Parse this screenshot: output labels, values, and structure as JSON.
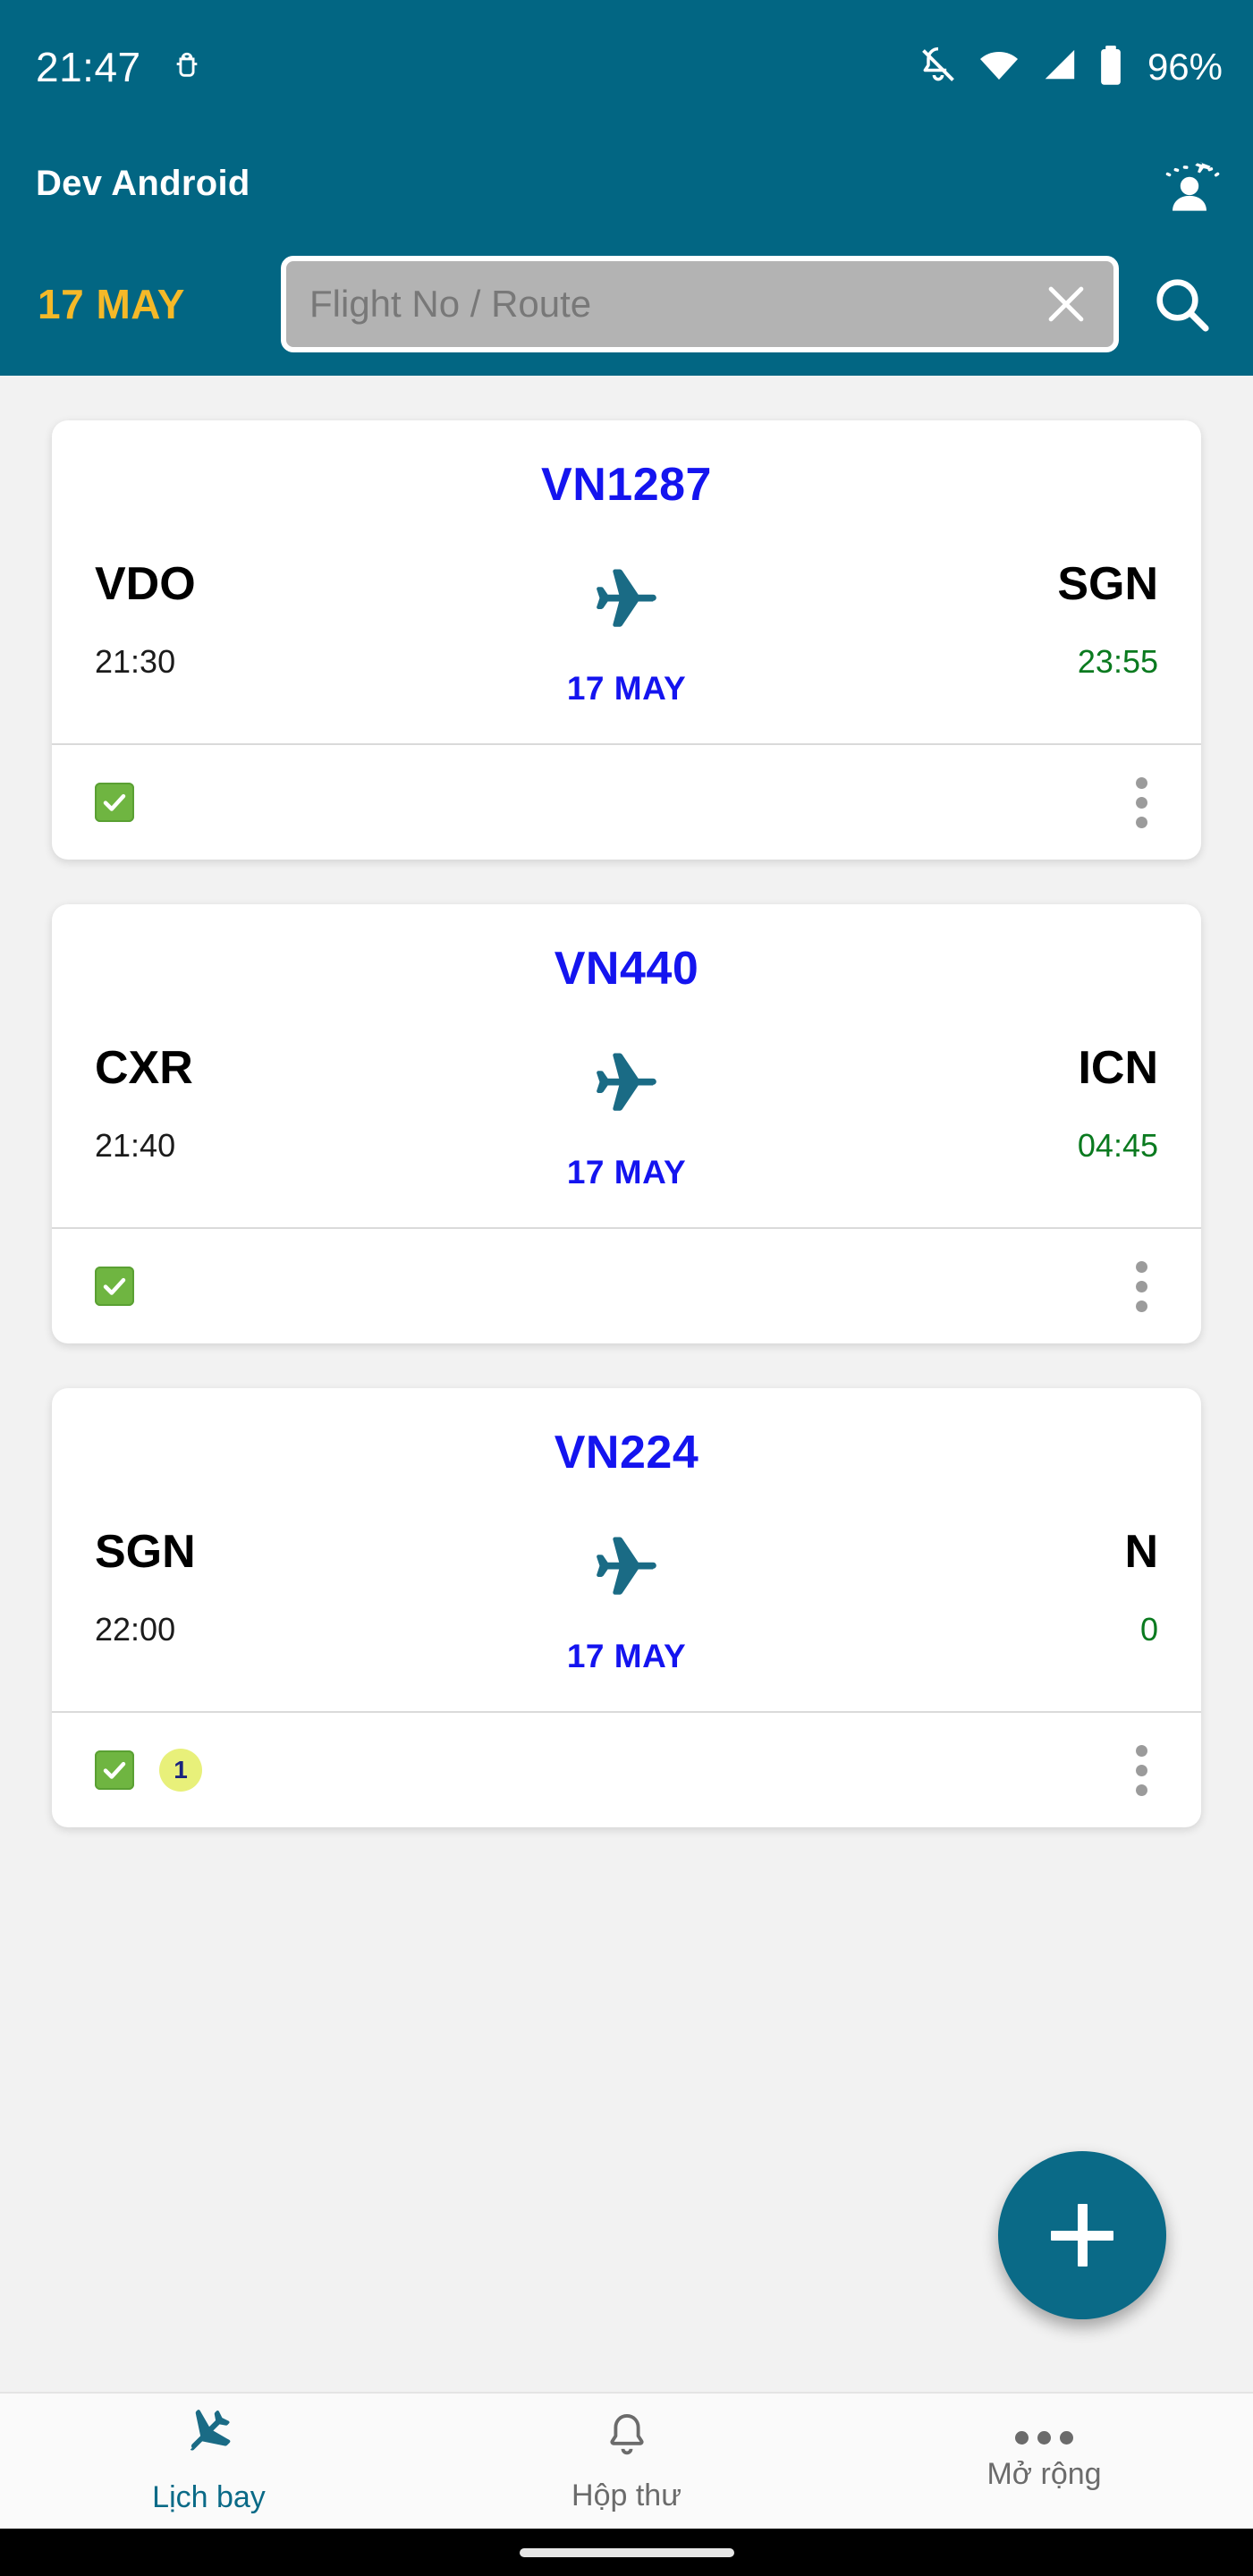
{
  "status_bar": {
    "clock": "21:47",
    "battery_text": "96%",
    "icons": [
      "android-debug-icon",
      "notifications-off-icon",
      "wifi-icon",
      "cellular-signal-icon",
      "battery-icon"
    ]
  },
  "app_bar": {
    "title": "Dev Android",
    "profile_icon": "crew-profile-icon",
    "date_label": "17 MAY",
    "search": {
      "placeholder": "Flight No / Route",
      "value": "",
      "clear_icon": "close-icon",
      "search_icon": "search-icon"
    }
  },
  "flights": [
    {
      "flight_no": "VN1287",
      "origin": "VDO",
      "destination": "SGN",
      "departure_time": "21:30",
      "arrival_time": "23:55",
      "date": "17 MAY",
      "checked": true,
      "badge": "",
      "menu_icon": "overflow-menu-icon",
      "plane_icon": "airplane-icon",
      "check_icon": "check-mark-icon"
    },
    {
      "flight_no": "VN440",
      "origin": "CXR",
      "destination": "ICN",
      "departure_time": "21:40",
      "arrival_time": "04:45",
      "date": "17 MAY",
      "checked": true,
      "badge": "",
      "menu_icon": "overflow-menu-icon",
      "plane_icon": "airplane-icon",
      "check_icon": "check-mark-icon"
    },
    {
      "flight_no": "VN224",
      "origin": "SGN",
      "destination": "N",
      "departure_time": "22:00",
      "arrival_time": "0",
      "date": "17 MAY",
      "checked": true,
      "badge": "1",
      "menu_icon": "overflow-menu-icon",
      "plane_icon": "airplane-icon",
      "check_icon": "check-mark-icon"
    }
  ],
  "fab": {
    "icon": "plus-icon",
    "label": "+"
  },
  "bottom_nav": {
    "items": [
      {
        "label": "Lịch bay",
        "icon": "airplane-icon",
        "active": true
      },
      {
        "label": "Hộp thư",
        "icon": "bell-icon",
        "active": false
      },
      {
        "label": "Mở rộng",
        "icon": "more-horizontal-icon",
        "active": false
      }
    ]
  },
  "colors": {
    "header_teal": "#026683",
    "accent_amber": "#f5b928",
    "flight_blue": "#1414ef",
    "arrival_green": "#0a7a1f",
    "fab_teal": "#0a6a87",
    "page_bg": "#f2f2f2",
    "badge_yellow": "#e8f07a",
    "check_green": "#6fb541"
  }
}
